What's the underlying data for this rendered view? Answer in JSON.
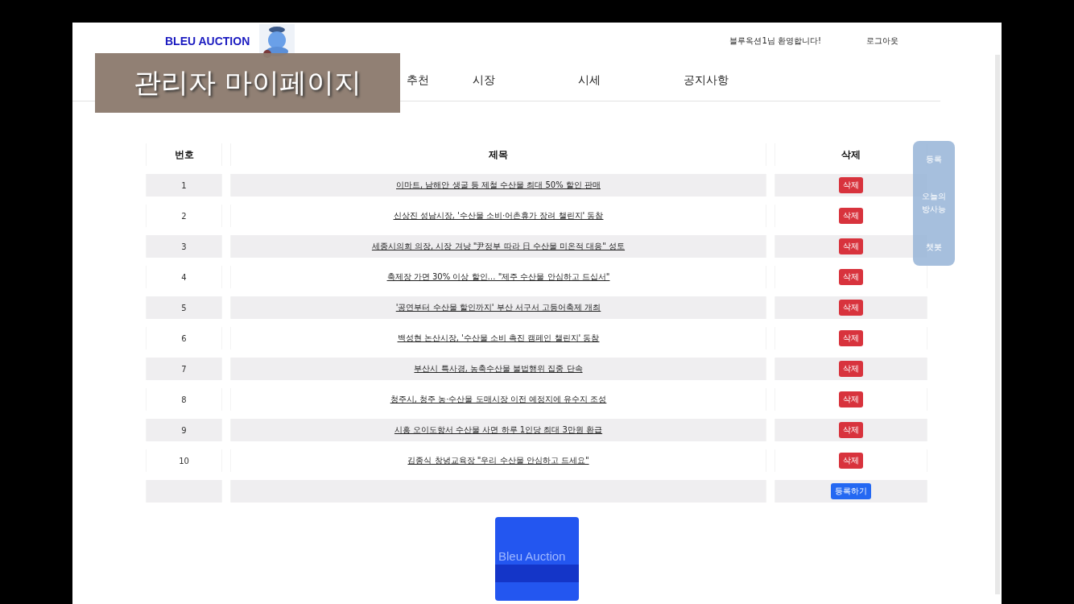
{
  "header": {
    "logo": "BLEU AUCTION",
    "welcome": "블루옥션1님 환영합니다!",
    "logout": "로그아웃"
  },
  "nav": [
    "추천",
    "시장",
    "시세",
    "공지사항"
  ],
  "caption": "관리자 마이페이지",
  "table": {
    "columns": [
      "번호",
      "제목",
      "삭제"
    ],
    "rows": [
      {
        "number": "1",
        "title": "이마트, 남해안 생굴 등 제철 수산물 최대 50% 할인 판매",
        "action": "삭제"
      },
      {
        "number": "2",
        "title": "신상진 성남시장, '수산물 소비·어촌휴가 장려 챌린지' 동참",
        "action": "삭제"
      },
      {
        "number": "3",
        "title": "세종시의회 의장, 시장 겨냥 \"尹정부 따라 日 수산물 미온적 대응\" 성토",
        "action": "삭제"
      },
      {
        "number": "4",
        "title": "축제장 가면 30% 이상 할인… \"제주 수산물 안심하고 드십서\"",
        "action": "삭제"
      },
      {
        "number": "5",
        "title": "'공연부터 수산물 할인까지' 부산 서구서 고등어축제 개최",
        "action": "삭제"
      },
      {
        "number": "6",
        "title": "백성현 논산시장, '수산물 소비 촉진 캠페인 챌린지' 동참",
        "action": "삭제"
      },
      {
        "number": "7",
        "title": "부산시 특사경, 농축수산물 불법행위 집중 단속",
        "action": "삭제"
      },
      {
        "number": "8",
        "title": "청주시, 청주 농·수산물 도매시장 이전 예정지에 유수지 조성",
        "action": "삭제"
      },
      {
        "number": "9",
        "title": "시흥 오이도항서 수산물 사면 하루 1인당 최대 3만원 환급",
        "action": "삭제"
      },
      {
        "number": "10",
        "title": "김종식 창녕교육장 \"우리 수산물 안심하고 드세요\"",
        "action": "삭제"
      }
    ],
    "footer_button": "등록하기"
  },
  "side_menu": [
    "등록",
    "오늘의 방사능",
    "챗봇"
  ],
  "footer_logo": "Bleu Auction"
}
